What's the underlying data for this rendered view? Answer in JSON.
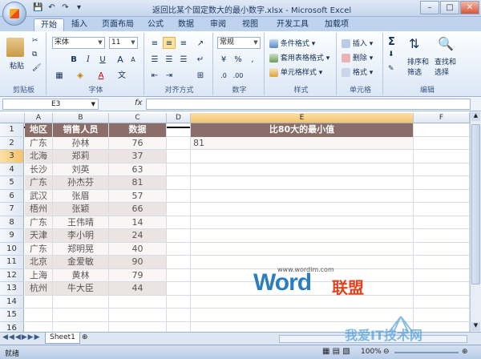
{
  "window": {
    "title": "返回比某个固定数大的最小数字.xlsx - Microsoft Excel"
  },
  "tabs": [
    "开始",
    "插入",
    "页面布局",
    "公式",
    "数据",
    "审阅",
    "视图",
    "开发工具",
    "加载项"
  ],
  "ribbon": {
    "clipboard": {
      "label": "剪贴板",
      "paste": "粘贴"
    },
    "font": {
      "label": "字体",
      "name": "宋体",
      "size": "11",
      "bold": "B",
      "italic": "I",
      "underline": "U",
      "grow": "A",
      "shrink": "A"
    },
    "alignment": {
      "label": "对齐方式"
    },
    "number": {
      "label": "数字",
      "format": "常规",
      "percent": "%",
      "comma": ","
    },
    "styles": {
      "label": "样式",
      "conditional": "条件格式",
      "table": "套用表格格式",
      "cell": "单元格样式"
    },
    "cells": {
      "label": "单元格",
      "insert": "插入",
      "delete": "删除",
      "format": "格式"
    },
    "editing": {
      "label": "编辑",
      "sigma": "Σ",
      "sort": "排序和",
      "sort2": "筛选",
      "find": "查找和",
      "find2": "选择"
    }
  },
  "formula_bar": {
    "name_box": "E3",
    "fx": "fx",
    "value": ""
  },
  "columns": [
    "A",
    "B",
    "C",
    "D",
    "E",
    "F"
  ],
  "rows": [
    "1",
    "2",
    "3",
    "4",
    "5",
    "6",
    "7",
    "8",
    "9",
    "10",
    "11",
    "12",
    "13",
    "14",
    "15",
    "16"
  ],
  "table": {
    "headers": [
      "地区",
      "销售人员",
      "数据"
    ],
    "rows": [
      [
        "广东",
        "孙林",
        "76"
      ],
      [
        "北海",
        "郑莉",
        "37"
      ],
      [
        "长沙",
        "刘英",
        "63"
      ],
      [
        "广东",
        "孙杰芬",
        "81"
      ],
      [
        "武汉",
        "张眉",
        "57"
      ],
      [
        "梧州",
        "张颖",
        "66"
      ],
      [
        "广东",
        "王伟晴",
        "14"
      ],
      [
        "天津",
        "李小明",
        "24"
      ],
      [
        "广东",
        "郑明晃",
        "40"
      ],
      [
        "北京",
        "金爱敏",
        "90"
      ],
      [
        "上海",
        "黄林",
        "79"
      ],
      [
        "杭州",
        "牛大臣",
        "44"
      ]
    ]
  },
  "result": {
    "header": "比80大的最小值",
    "value": "81"
  },
  "watermark": {
    "url": "www.wordlm.com",
    "word": "Word",
    "cn": "联盟",
    "bottom": "我爱IT技术网"
  },
  "sheet_tab": "Sheet1",
  "status": {
    "ready": "就绪",
    "zoom": "100%"
  },
  "colors": {
    "header_bg": "#8b6e6a",
    "even_row": "#ece4e3",
    "odd_row": "#faf6f6",
    "accent": "#f5c36b"
  }
}
